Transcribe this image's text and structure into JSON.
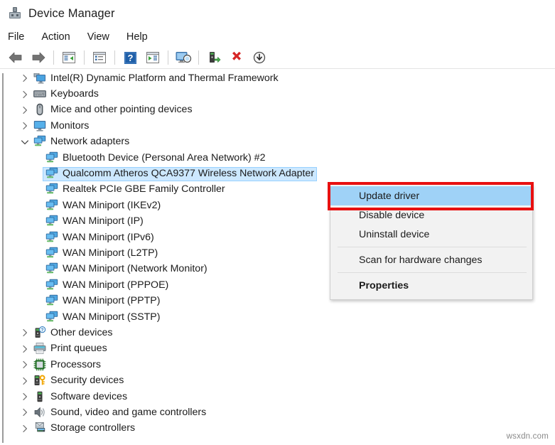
{
  "window": {
    "title": "Device Manager",
    "icon": "device-manager-icon"
  },
  "menubar": {
    "items": [
      {
        "label": "File",
        "name": "menu-file"
      },
      {
        "label": "Action",
        "name": "menu-action"
      },
      {
        "label": "View",
        "name": "menu-view"
      },
      {
        "label": "Help",
        "name": "menu-help"
      }
    ]
  },
  "toolbar": {
    "buttons": [
      {
        "icon": "back-arrow-icon",
        "name": "toolbar-back"
      },
      {
        "icon": "forward-arrow-icon",
        "name": "toolbar-forward"
      },
      {
        "sep": true
      },
      {
        "icon": "show-hide-console-tree-icon",
        "name": "toolbar-console-tree"
      },
      {
        "sep": true
      },
      {
        "icon": "properties-icon",
        "name": "toolbar-properties"
      },
      {
        "sep": true
      },
      {
        "icon": "help-icon",
        "name": "toolbar-help"
      },
      {
        "icon": "show-hide-action-pane-icon",
        "name": "toolbar-action-pane"
      },
      {
        "sep": true
      },
      {
        "icon": "scan-hardware-changes-icon",
        "name": "toolbar-scan-hardware"
      },
      {
        "sep": true
      },
      {
        "icon": "update-driver-icon",
        "name": "toolbar-update-driver"
      },
      {
        "icon": "uninstall-device-icon",
        "name": "toolbar-uninstall-device"
      },
      {
        "icon": "disable-device-icon",
        "name": "toolbar-disable-device"
      }
    ]
  },
  "tree": {
    "items": [
      {
        "label": "Intel(R) Dynamic Platform and Thermal Framework",
        "indent": 0,
        "chevron": "collapsed",
        "icon": "thermal-framework-icon",
        "selected": false
      },
      {
        "label": "Keyboards",
        "indent": 0,
        "chevron": "collapsed",
        "icon": "keyboard-icon",
        "selected": false
      },
      {
        "label": "Mice and other pointing devices",
        "indent": 0,
        "chevron": "collapsed",
        "icon": "mouse-icon",
        "selected": false
      },
      {
        "label": "Monitors",
        "indent": 0,
        "chevron": "collapsed",
        "icon": "monitor-icon",
        "selected": false
      },
      {
        "label": "Network adapters",
        "indent": 0,
        "chevron": "expanded",
        "icon": "network-adapter-icon",
        "selected": false
      },
      {
        "label": "Bluetooth Device (Personal Area Network) #2",
        "indent": 1,
        "chevron": "none",
        "icon": "network-adapter-icon",
        "selected": false
      },
      {
        "label": "Qualcomm Atheros QCA9377 Wireless Network Adapter",
        "indent": 1,
        "chevron": "none",
        "icon": "network-adapter-icon",
        "selected": true
      },
      {
        "label": "Realtek PCIe GBE Family Controller",
        "indent": 1,
        "chevron": "none",
        "icon": "network-adapter-icon",
        "selected": false
      },
      {
        "label": "WAN Miniport (IKEv2)",
        "indent": 1,
        "chevron": "none",
        "icon": "network-adapter-icon",
        "selected": false
      },
      {
        "label": "WAN Miniport (IP)",
        "indent": 1,
        "chevron": "none",
        "icon": "network-adapter-icon",
        "selected": false
      },
      {
        "label": "WAN Miniport (IPv6)",
        "indent": 1,
        "chevron": "none",
        "icon": "network-adapter-icon",
        "selected": false
      },
      {
        "label": "WAN Miniport (L2TP)",
        "indent": 1,
        "chevron": "none",
        "icon": "network-adapter-icon",
        "selected": false
      },
      {
        "label": "WAN Miniport (Network Monitor)",
        "indent": 1,
        "chevron": "none",
        "icon": "network-adapter-icon",
        "selected": false
      },
      {
        "label": "WAN Miniport (PPPOE)",
        "indent": 1,
        "chevron": "none",
        "icon": "network-adapter-icon",
        "selected": false
      },
      {
        "label": "WAN Miniport (PPTP)",
        "indent": 1,
        "chevron": "none",
        "icon": "network-adapter-icon",
        "selected": false
      },
      {
        "label": "WAN Miniport (SSTP)",
        "indent": 1,
        "chevron": "none",
        "icon": "network-adapter-icon",
        "selected": false
      },
      {
        "label": "Other devices",
        "indent": 0,
        "chevron": "collapsed",
        "icon": "other-devices-icon",
        "selected": false
      },
      {
        "label": "Print queues",
        "indent": 0,
        "chevron": "collapsed",
        "icon": "printer-icon",
        "selected": false
      },
      {
        "label": "Processors",
        "indent": 0,
        "chevron": "collapsed",
        "icon": "processor-icon",
        "selected": false
      },
      {
        "label": "Security devices",
        "indent": 0,
        "chevron": "collapsed",
        "icon": "security-device-icon",
        "selected": false
      },
      {
        "label": "Software devices",
        "indent": 0,
        "chevron": "collapsed",
        "icon": "software-device-icon",
        "selected": false
      },
      {
        "label": "Sound, video and game controllers",
        "indent": 0,
        "chevron": "collapsed",
        "icon": "sound-icon",
        "selected": false
      },
      {
        "label": "Storage controllers",
        "indent": 0,
        "chevron": "collapsed",
        "icon": "storage-controller-icon",
        "selected": false
      }
    ]
  },
  "context_menu": {
    "items": [
      {
        "label": "Update driver",
        "highlighted": true,
        "bold": false,
        "separator_after": false
      },
      {
        "label": "Disable device",
        "highlighted": false,
        "bold": false,
        "separator_after": false
      },
      {
        "label": "Uninstall device",
        "highlighted": false,
        "bold": false,
        "separator_after": true
      },
      {
        "label": "Scan for hardware changes",
        "highlighted": false,
        "bold": false,
        "separator_after": true
      },
      {
        "label": "Properties",
        "highlighted": false,
        "bold": true,
        "separator_after": false
      }
    ]
  },
  "annotation": {
    "highlight_color": "#e81010",
    "target_label": "Update driver"
  },
  "watermark": {
    "text": "wsxdn.com"
  },
  "colors": {
    "selection": "#cce8ff",
    "menu_highlight": "#9fd2f7",
    "menu_bg": "#f2f2f2",
    "annotation_red": "#e81010"
  }
}
